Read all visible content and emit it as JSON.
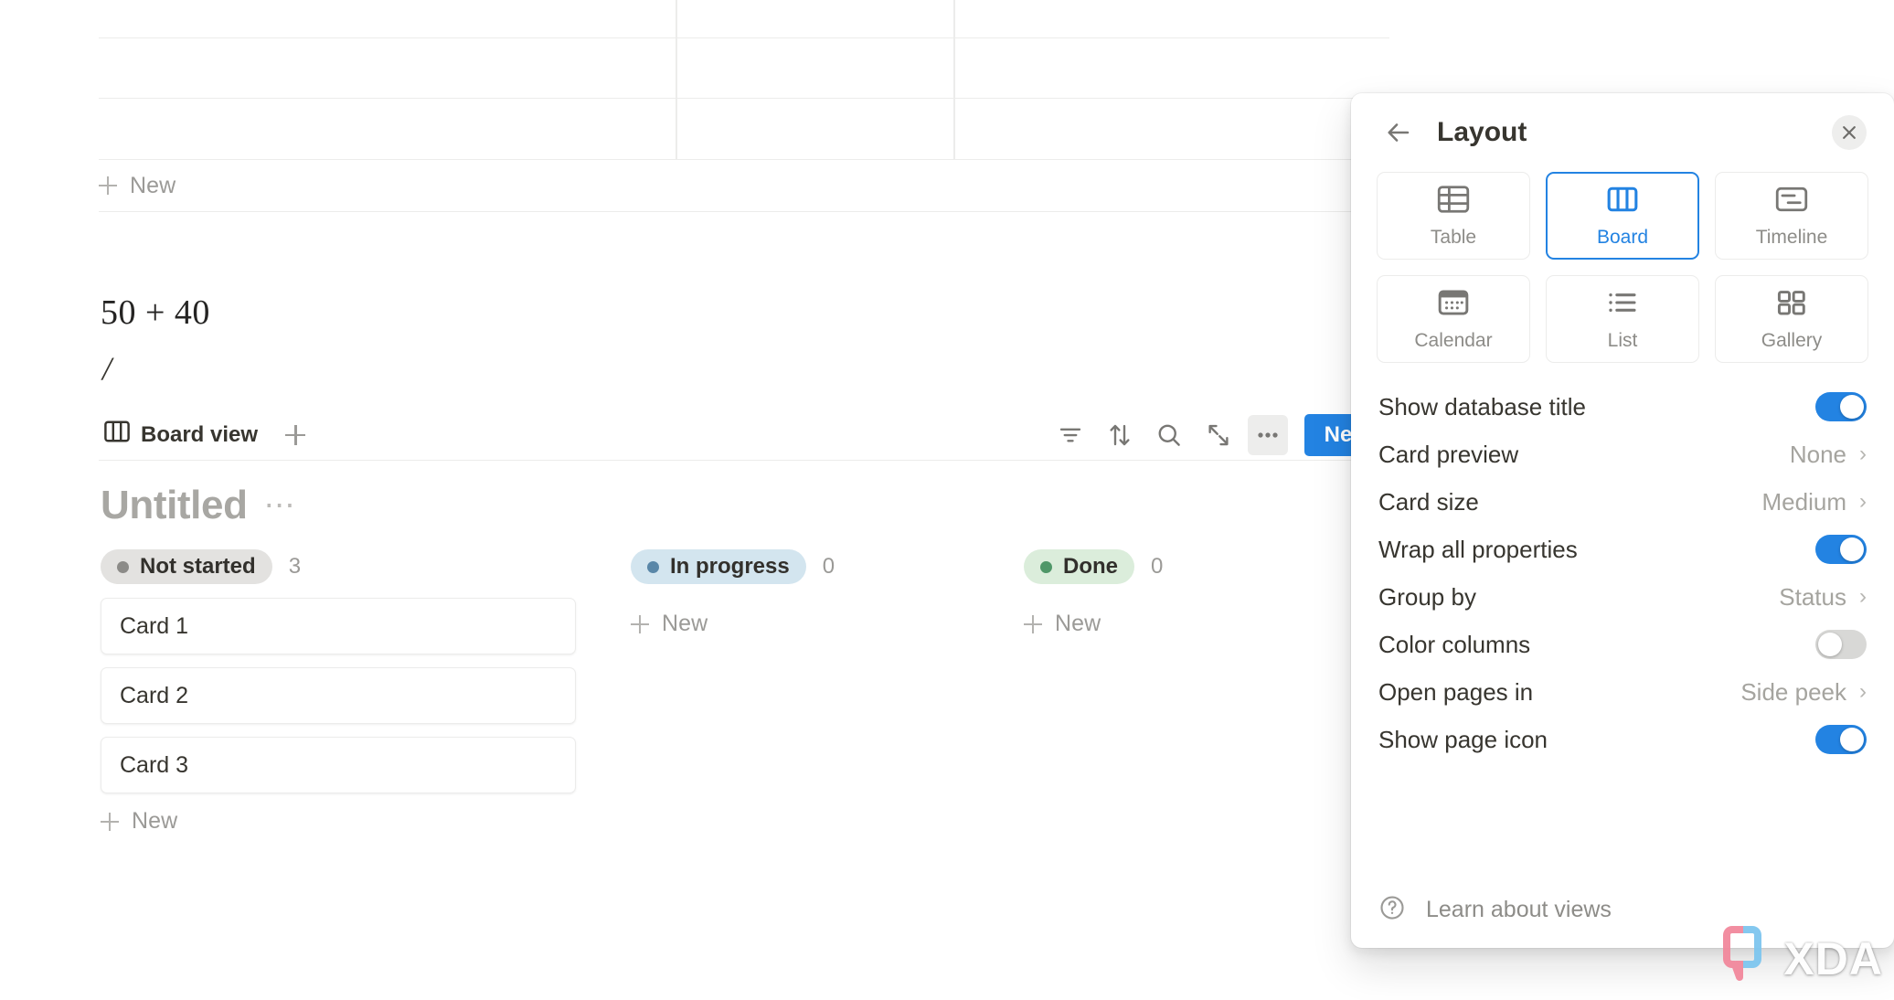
{
  "table": {
    "new_label": "New"
  },
  "blocks": {
    "equation": "50 + 40",
    "slash_command": "/"
  },
  "view_bar": {
    "view_tab_label": "Board view",
    "add_view_icon": "plus-icon",
    "board_icon": "board-view-icon",
    "actions": [
      {
        "name": "filter-icon",
        "label": "Filter"
      },
      {
        "name": "sort-icon",
        "label": "Sort"
      },
      {
        "name": "search-icon",
        "label": "Search"
      },
      {
        "name": "expand-icon",
        "label": "Expand"
      },
      {
        "name": "more-options-icon",
        "label": "More options"
      }
    ],
    "new_button_label": "New"
  },
  "database": {
    "title": "Untitled",
    "title_menu_icon": "ellipsis-icon"
  },
  "board": {
    "new_label": "New",
    "columns": [
      {
        "status": "Not started",
        "count": "3",
        "dot_color": "#8c8b88",
        "pill_bg": "#e3e2e0",
        "cards": [
          "Card 1",
          "Card 2",
          "Card 3"
        ]
      },
      {
        "status": "In progress",
        "count": "0",
        "dot_color": "#5a87a8",
        "pill_bg": "#d3e5ef",
        "cards": []
      },
      {
        "status": "Done",
        "count": "0",
        "dot_color": "#4f9768",
        "pill_bg": "#dbeddb",
        "cards": []
      }
    ]
  },
  "layout_panel": {
    "title": "Layout",
    "back_icon": "arrow-left-icon",
    "close_icon": "close-icon",
    "selected_layout": "Board",
    "layout_options": [
      {
        "label": "Table",
        "icon": "table-icon"
      },
      {
        "label": "Board",
        "icon": "board-icon"
      },
      {
        "label": "Timeline",
        "icon": "timeline-icon"
      },
      {
        "label": "Calendar",
        "icon": "calendar-icon"
      },
      {
        "label": "List",
        "icon": "list-icon"
      },
      {
        "label": "Gallery",
        "icon": "gallery-icon"
      }
    ],
    "settings": [
      {
        "label": "Show database title",
        "type": "toggle",
        "value": "on"
      },
      {
        "label": "Card preview",
        "type": "value",
        "value": "None"
      },
      {
        "label": "Card size",
        "type": "value",
        "value": "Medium"
      },
      {
        "label": "Wrap all properties",
        "type": "toggle",
        "value": "on"
      },
      {
        "label": "Group by",
        "type": "value",
        "value": "Status"
      },
      {
        "label": "Color columns",
        "type": "toggle",
        "value": "off"
      },
      {
        "label": "Open pages in",
        "type": "value",
        "value": "Side peek"
      },
      {
        "label": "Show page icon",
        "type": "toggle",
        "value": "on"
      }
    ],
    "footer_label": "Learn about views",
    "footer_icon": "question-circle-icon",
    "accent_color": "#2383e2"
  },
  "watermark": {
    "text": "XDA",
    "logo_icon": "xda-logo-icon",
    "pink": "#f2889c",
    "blue": "#7ec6ef"
  }
}
